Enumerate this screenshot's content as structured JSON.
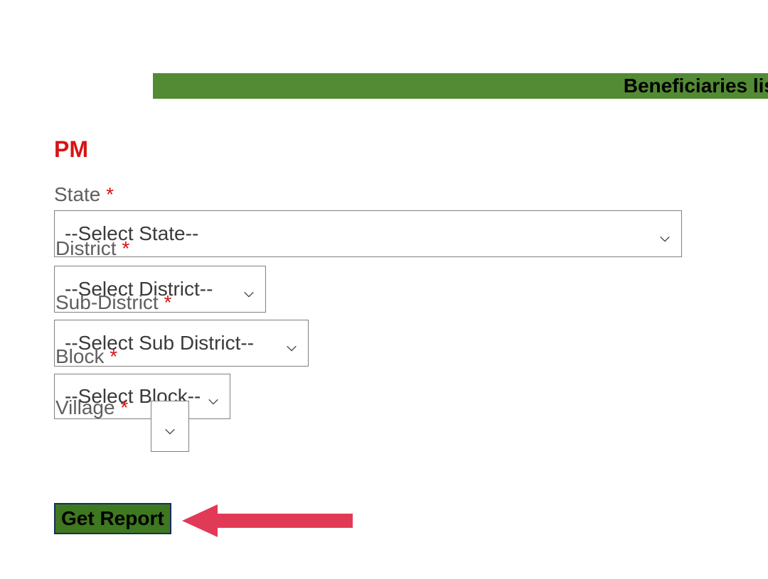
{
  "header": {
    "title": "Beneficiaries lis"
  },
  "pm_label": "PM",
  "fields": {
    "state": {
      "label": "State",
      "selected": "--Select State--"
    },
    "district": {
      "label": "District",
      "selected": "--Select District--"
    },
    "sub_district": {
      "label": "Sub-District",
      "selected": "--Select Sub District--"
    },
    "block": {
      "label": "Block",
      "selected": "--Select Block--"
    },
    "village": {
      "label": "Village",
      "selected": ""
    }
  },
  "required_mark": "*",
  "button": {
    "get_report": "Get Report"
  }
}
